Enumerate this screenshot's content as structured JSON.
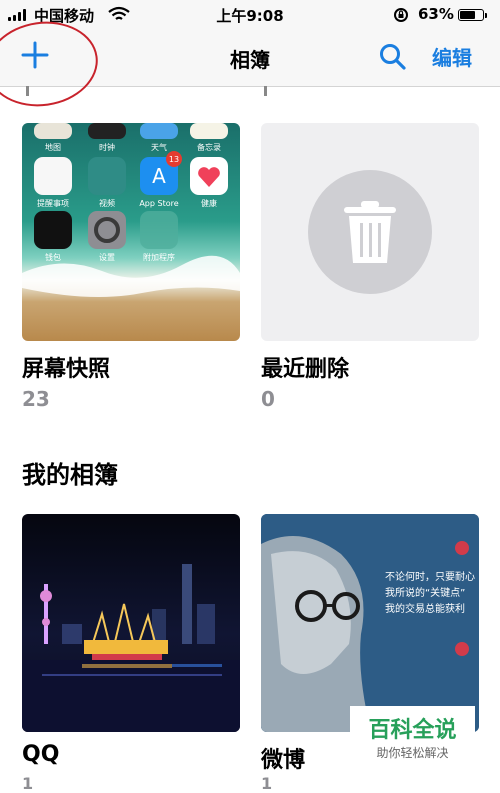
{
  "status_bar": {
    "carrier": "中国移动",
    "time": "上午9:08",
    "battery_percent": "63%",
    "battery_level": 0.63
  },
  "nav": {
    "title": "相簿",
    "edit_label": "编辑"
  },
  "albums_top": [
    {
      "name": "屏幕快照",
      "count": "23"
    },
    {
      "name": "最近删除",
      "count": "0"
    }
  ],
  "home_screen_apps": [
    "地图",
    "时钟",
    "天气",
    "备忘录",
    "提醒事项",
    "视频",
    "App Store",
    "健康",
    "钱包",
    "设置",
    "附加程序"
  ],
  "appstore_badge": "13",
  "section_title": "我的相簿",
  "albums_mine": [
    {
      "name": "QQ",
      "count": "1"
    },
    {
      "name": "微博",
      "count": "1"
    }
  ],
  "weibo_quote": [
    "不论何时，只要耐心",
    "我所说的“关键点”",
    "我的交易总能获利"
  ],
  "watermark": {
    "title": "百科全说",
    "subtitle": "助你轻松解决"
  },
  "colors": {
    "accent": "#1a7ee0",
    "annotation_circle": "#c8232c",
    "watermark": "#27a05a"
  }
}
